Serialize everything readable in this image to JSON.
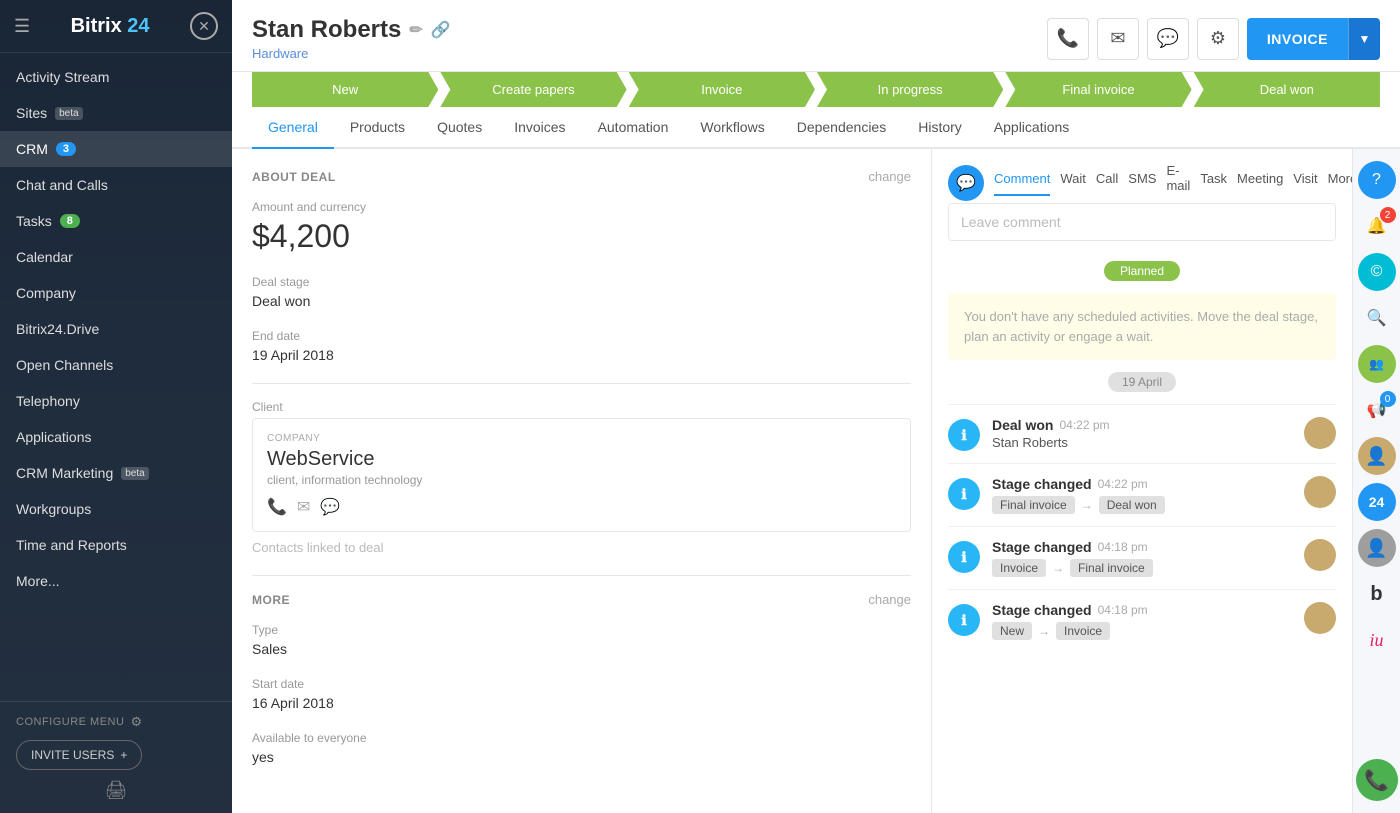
{
  "sidebar": {
    "logo": "Bitrix 24",
    "logo_bitrix": "Bitrix",
    "logo_num": "24",
    "items": [
      {
        "id": "activity-stream",
        "label": "Activity Stream",
        "badge": null
      },
      {
        "id": "sites",
        "label": "Sites",
        "beta": true,
        "badge": null
      },
      {
        "id": "crm",
        "label": "CRM",
        "badge": "3",
        "badge_type": "blue",
        "active": true
      },
      {
        "id": "chat-calls",
        "label": "Chat and Calls",
        "badge": null
      },
      {
        "id": "tasks",
        "label": "Tasks",
        "badge": "8",
        "badge_type": "green"
      },
      {
        "id": "calendar",
        "label": "Calendar",
        "badge": null
      },
      {
        "id": "company",
        "label": "Company",
        "badge": null
      },
      {
        "id": "bitrix24drive",
        "label": "Bitrix24.Drive",
        "badge": null
      },
      {
        "id": "open-channels",
        "label": "Open Channels",
        "badge": null
      },
      {
        "id": "telephony",
        "label": "Telephony",
        "badge": null
      },
      {
        "id": "applications",
        "label": "Applications",
        "badge": null
      },
      {
        "id": "crm-marketing",
        "label": "CRM Marketing",
        "beta": true,
        "badge": null
      },
      {
        "id": "workgroups",
        "label": "Workgroups",
        "badge": null
      },
      {
        "id": "time-reports",
        "label": "Time and Reports",
        "badge": null
      },
      {
        "id": "more",
        "label": "More...",
        "badge": null
      }
    ],
    "configure_menu": "CONFIGURE MENU",
    "invite_users": "INVITE USERS"
  },
  "deal": {
    "name": "Stan Roberts",
    "subtitle": "Hardware",
    "pipeline_stages": [
      {
        "id": "new",
        "label": "New",
        "active": true
      },
      {
        "id": "create-papers",
        "label": "Create papers",
        "active": true
      },
      {
        "id": "invoice",
        "label": "Invoice",
        "active": true
      },
      {
        "id": "in-progress",
        "label": "In progress",
        "active": true
      },
      {
        "id": "final-invoice",
        "label": "Final invoice",
        "active": true
      },
      {
        "id": "deal-won",
        "label": "Deal won",
        "active": true
      }
    ],
    "tabs": [
      {
        "id": "general",
        "label": "General",
        "active": true
      },
      {
        "id": "products",
        "label": "Products"
      },
      {
        "id": "quotes",
        "label": "Quotes"
      },
      {
        "id": "invoices",
        "label": "Invoices"
      },
      {
        "id": "automation",
        "label": "Automation"
      },
      {
        "id": "workflows",
        "label": "Workflows"
      },
      {
        "id": "dependencies",
        "label": "Dependencies"
      },
      {
        "id": "history",
        "label": "History"
      },
      {
        "id": "applications",
        "label": "Applications"
      }
    ],
    "about_deal": "ABOUT DEAL",
    "amount_label": "Amount and currency",
    "amount": "$4,200",
    "deal_stage_label": "Deal stage",
    "deal_stage": "Deal won",
    "end_date_label": "End date",
    "end_date": "19 April 2018",
    "client_label": "Client",
    "company_label": "COMPANY",
    "company_name": "WebService",
    "company_desc": "client, information technology",
    "contacts_linked": "Contacts linked to deal",
    "more_label": "MORE",
    "type_label": "Type",
    "type_value": "Sales",
    "start_date_label": "Start date",
    "start_date": "16 April 2018",
    "available_label": "Available to everyone",
    "available_value": "yes",
    "change": "change"
  },
  "activity": {
    "tabs": [
      {
        "id": "comment",
        "label": "Comment",
        "active": true
      },
      {
        "id": "wait",
        "label": "Wait"
      },
      {
        "id": "call",
        "label": "Call"
      },
      {
        "id": "sms",
        "label": "SMS"
      },
      {
        "id": "email",
        "label": "E-mail"
      },
      {
        "id": "task",
        "label": "Task"
      },
      {
        "id": "meeting",
        "label": "Meeting"
      },
      {
        "id": "visit",
        "label": "Visit"
      },
      {
        "id": "more",
        "label": "More..."
      }
    ],
    "comment_placeholder": "Leave comment",
    "planned_badge": "Planned",
    "no_activities_text": "You don't have any scheduled activities. Move the deal stage, plan an activity or engage a wait.",
    "date_separator": "19 April",
    "items": [
      {
        "id": "item1",
        "type": "deal-won",
        "title": "Deal won",
        "time": "04:22 pm",
        "subtitle": "Stan Roberts",
        "stage_from": null,
        "stage_to": null
      },
      {
        "id": "item2",
        "type": "stage-changed",
        "title": "Stage changed",
        "time": "04:22 pm",
        "subtitle": null,
        "stage_from": "Final invoice",
        "stage_to": "Deal won"
      },
      {
        "id": "item3",
        "type": "stage-changed",
        "title": "Stage changed",
        "time": "04:18 pm",
        "subtitle": null,
        "stage_from": "Invoice",
        "stage_to": "Final invoice"
      },
      {
        "id": "item4",
        "type": "stage-changed",
        "title": "Stage changed",
        "time": "04:18 pm",
        "subtitle": null,
        "stage_from": "New",
        "stage_to": "Invoice"
      }
    ]
  },
  "buttons": {
    "invoice_label": "INVOICE",
    "change_label": "change"
  }
}
